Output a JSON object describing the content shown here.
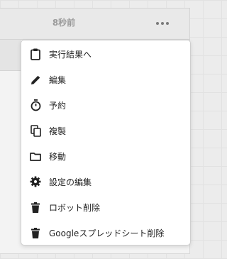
{
  "card": {
    "timestamp": "8秒前",
    "more_icon": "more-horizontal-icon"
  },
  "menu": {
    "items": [
      {
        "label": "実行結果へ",
        "icon": "clipboard-icon"
      },
      {
        "label": "編集",
        "icon": "pencil-icon"
      },
      {
        "label": "予約",
        "icon": "stopwatch-icon"
      },
      {
        "label": "複製",
        "icon": "copy-icon"
      },
      {
        "label": "移動",
        "icon": "folder-icon"
      },
      {
        "label": "設定の編集",
        "icon": "gear-icon"
      },
      {
        "label": "ロボット削除",
        "icon": "trash-icon"
      },
      {
        "label": "Googleスプレッドシート削除",
        "icon": "trash-icon"
      }
    ]
  }
}
